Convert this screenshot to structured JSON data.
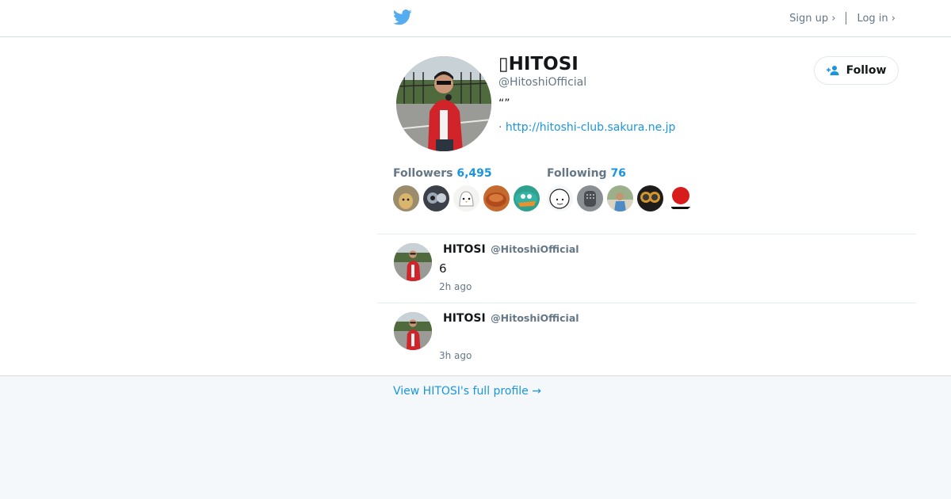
{
  "header": {
    "logo_icon": "twitter-bird-icon",
    "sign_up": "Sign up ›",
    "log_in": "Log in ›"
  },
  "profile": {
    "name": "▯",
    "name_text": "HITOSI",
    "handle": "@HitoshiOfficial",
    "bio": "“”",
    "url_prefix": "·",
    "url": "http://hitoshi-club.sakura.ne.jp",
    "follow_label": "Follow",
    "follow_icon": "add-user-icon"
  },
  "stats": {
    "followers_label": "Followers",
    "followers_count": "6,495",
    "following_label": "Following",
    "following_count": "76"
  },
  "tweets": [
    {
      "name": "HITOSI",
      "handle": "@HitoshiOfficial",
      "text": "6",
      "time": "2h ago"
    },
    {
      "name": "HITOSI",
      "handle": "@HitoshiOfficial",
      "text": "",
      "time": "3h ago"
    }
  ],
  "footer": {
    "full_profile_link": "View HITOSI's full profile →"
  },
  "colors": {
    "accent": "#1b95e0",
    "bird": "#55acee",
    "muted": "#657786",
    "page_background": "#f5f8fa"
  }
}
